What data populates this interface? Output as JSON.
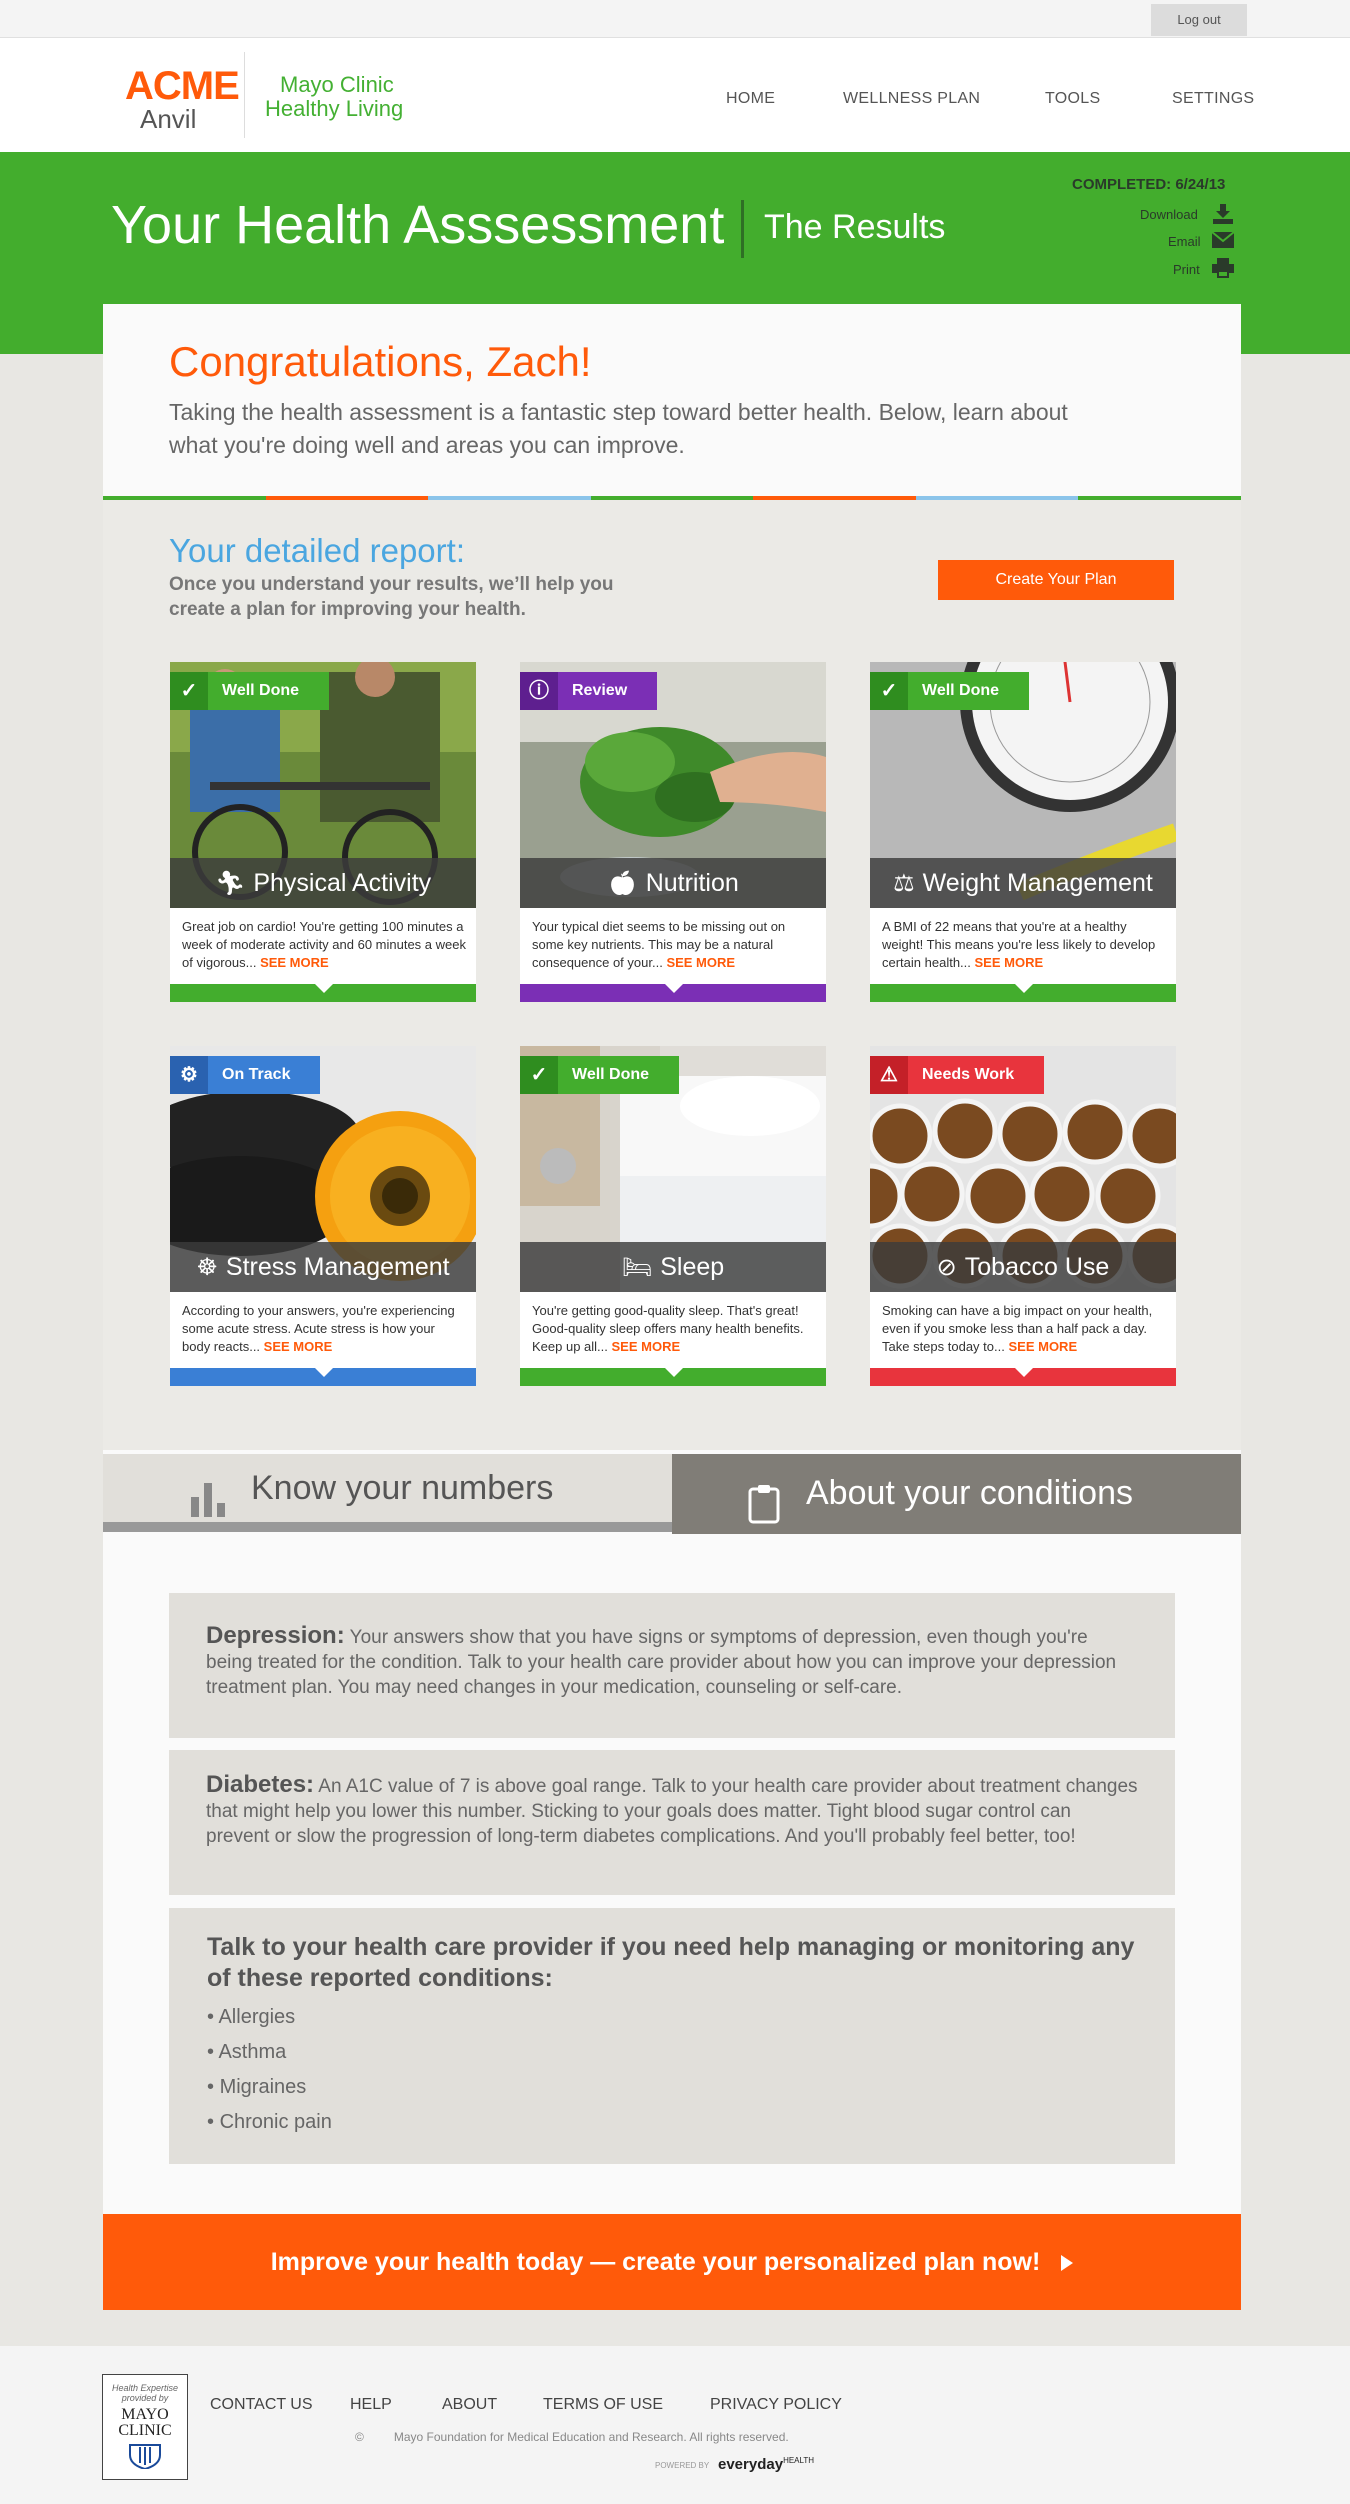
{
  "topbar": {
    "logout": "Log out"
  },
  "header": {
    "brand": "ACME",
    "brand_sub": "Anvil",
    "partner_line1": "Mayo Clinic",
    "partner_line2": "Healthy Living",
    "nav": [
      "HOME",
      "WELLNESS PLAN",
      "TOOLS",
      "SETTINGS"
    ]
  },
  "banner": {
    "title": "Your Health Asssessment",
    "subtitle": "The Results",
    "completed": "COMPLETED: 6/24/13",
    "actions": [
      "Download",
      "Email",
      "Print"
    ]
  },
  "intro": {
    "greeting": "Congratulations, Zach!",
    "text": "Taking the health assessment is a fantastic step toward better health. Below, learn about what you're doing well and areas you can improve."
  },
  "report": {
    "title": "Your detailed report:",
    "subtitle": "Once you understand your results, we’ll help you create a plan for improving your health.",
    "button": "Create Your Plan"
  },
  "cards": [
    {
      "title": "Physical Activity",
      "badge": "Well Done",
      "text": "Great job on cardio! You're getting 100 minutes a week of moderate activity and 60 minutes a week of vigorous...",
      "more": "SEE MORE",
      "color": "#43ad2d",
      "icon": "running-icon",
      "badge_icon": "checkmark-icon"
    },
    {
      "title": "Nutrition",
      "badge": "Review",
      "text": "Your typical diet seems to be missing out on some key nutrients. This may be a natural consequence of your...",
      "more": "SEE MORE",
      "color": "#7b2fb5",
      "icon": "apple-icon",
      "badge_icon": "info-icon"
    },
    {
      "title": "Weight Management",
      "badge": "Well Done",
      "text": "A BMI of 22 means that you're at a healthy weight! This means you're less likely to develop certain health...",
      "more": "SEE MORE",
      "color": "#43ad2d",
      "icon": "scale-icon",
      "badge_icon": "checkmark-icon"
    },
    {
      "title": "Stress Management",
      "badge": "On Track",
      "text": "According to your answers, you're experiencing some acute stress. Acute stress is how your body reacts...",
      "more": "SEE MORE",
      "color": "#3a7fd5",
      "icon": "meditation-icon",
      "badge_icon": "gear-icon"
    },
    {
      "title": "Sleep",
      "badge": "Well Done",
      "text": "You're getting good-quality sleep. That's great! Good-quality sleep offers many health benefits. Keep up all...",
      "more": "SEE MORE",
      "color": "#43ad2d",
      "icon": "bed-icon",
      "badge_icon": "checkmark-icon"
    },
    {
      "title": "Tobacco Use",
      "badge": "Needs Work",
      "text": "Smoking can have a big impact on your health, even if you smoke less than a half pack a day. Take steps today to...",
      "more": "SEE MORE",
      "color": "#e8343d",
      "icon": "no-smoking-icon",
      "badge_icon": "warning-icon"
    }
  ],
  "tabs": {
    "numbers": "Know your numbers",
    "conditions": "About your conditions"
  },
  "conditions": {
    "depression_title": "Depression:",
    "depression_text": "Your answers show that you have signs or symptoms of depression, even though you're being treated for the condition. Talk to your health care provider about how you can improve your depression treatment plan. You may need changes in your medication, counseling or self-care.",
    "diabetes_title": "Diabetes:",
    "diabetes_text": "An A1C value of 7 is above goal range. Talk to your health care provider about treatment changes that might help you lower this number. Sticking to your goals does matter. Tight blood sugar control can prevent or slow the progression of long-term diabetes complications. And you'll probably feel better, too!",
    "talk_title": "Talk to your health care provider if you need help managing or monitoring any of these reported conditions:",
    "list": [
      "Allergies",
      "Asthma",
      "Migraines",
      "Chronic pain"
    ]
  },
  "cta": "Improve your health today — create your personalized plan now!",
  "footer": {
    "badge_line1": "Health Expertise",
    "badge_line2": "provided by",
    "badge_line3": "MAYO",
    "badge_line4": "CLINIC",
    "links": [
      "CONTACT US",
      "HELP",
      "ABOUT",
      "TERMS OF USE",
      "PRIVACY POLICY"
    ],
    "copyright": "Mayo Foundation for Medical Education and Research. All rights reserved.",
    "copyright_symbol": "©",
    "powered_by": "POWERED BY",
    "everyday": "everyday",
    "everyday_health": "HEALTH"
  }
}
